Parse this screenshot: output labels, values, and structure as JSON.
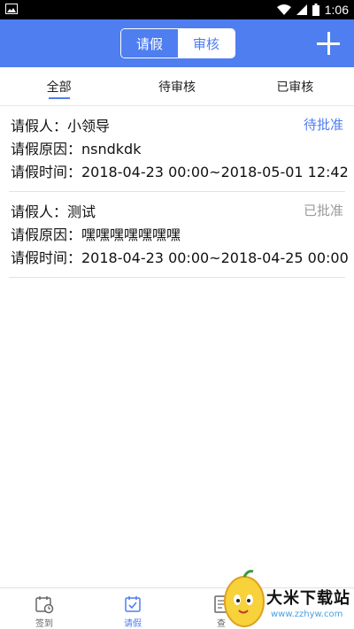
{
  "status_bar": {
    "time": "1:06"
  },
  "header": {
    "segments": [
      "请假",
      "审核"
    ],
    "active_segment": 1
  },
  "tabs": [
    {
      "label": "全部",
      "active": true
    },
    {
      "label": "待审核",
      "active": false
    },
    {
      "label": "已审核",
      "active": false
    }
  ],
  "requests": [
    {
      "applicant": "请假人：小领导",
      "reason": "请假原因：nsndkdk",
      "time": "请假时间：2018-04-23 00:00~2018-05-01 12:42",
      "status": "待批准",
      "status_color": "#4f7ef0"
    },
    {
      "applicant": "请假人：测试",
      "reason": "请假原因：嘿嘿嘿嘿嘿嘿嘿",
      "time": "请假时间：2018-04-23 00:00~2018-04-25 00:00",
      "status": "已批准",
      "status_color": "#9a9a9a"
    }
  ],
  "bottom_nav": [
    {
      "label": "签到",
      "icon": "calendar-clock-icon",
      "active": false
    },
    {
      "label": "请假",
      "icon": "calendar-check-icon",
      "active": true
    },
    {
      "label": "查",
      "icon": "document-icon",
      "active": false
    }
  ],
  "watermark": {
    "text": "大米下载站",
    "url": "www.zzhyw.com"
  },
  "colors": {
    "accent": "#4f7ef0",
    "status_bar": "#000000"
  }
}
